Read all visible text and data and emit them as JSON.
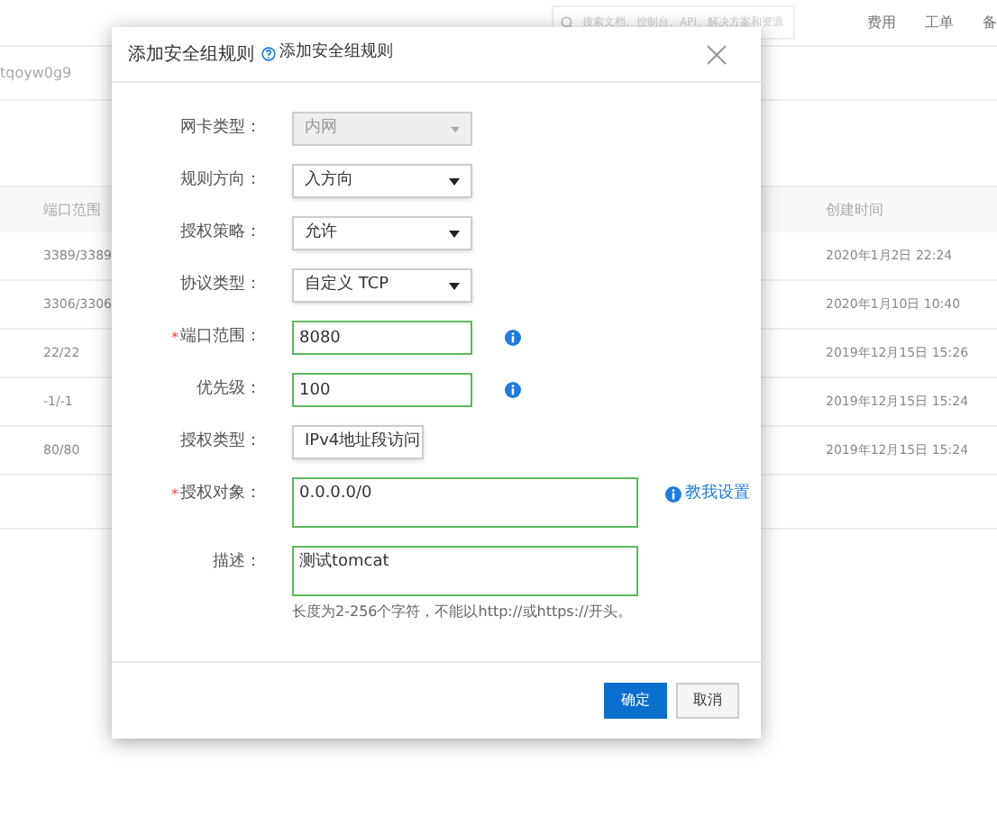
{
  "header": {
    "search": {
      "placeholder": "搜索文档、控制台、API、解决方案和资源"
    },
    "links": [
      "费用",
      "工单",
      "备"
    ]
  },
  "page": {
    "id_text": "tqoyw0g9",
    "table": {
      "columns": [
        "端口范围",
        "创建时间"
      ],
      "rows": [
        [
          "3389/3389",
          "2020年1月2日 22:24"
        ],
        [
          "3306/3306",
          "2020年1月10日 10:40"
        ],
        [
          "22/22",
          "2019年12月15日 15:26"
        ],
        [
          "-1/-1",
          "2019年12月15日 15:24"
        ],
        [
          "80/80",
          "2019年12月15日 15:24"
        ]
      ]
    }
  },
  "dialog": {
    "title": "添加安全组规则",
    "help_link": "添加安全组规则",
    "fields": [
      {
        "kind": "select",
        "label": "网卡类型：",
        "value": "内网",
        "disabled": true
      },
      {
        "kind": "select",
        "label": "规则方向：",
        "value": "入方向",
        "disabled": false
      },
      {
        "kind": "select",
        "label": "授权策略：",
        "value": "允许",
        "disabled": false
      },
      {
        "kind": "select",
        "label": "协议类型：",
        "value": "自定义 TCP",
        "disabled": false
      },
      {
        "kind": "input",
        "label": "端口范围：",
        "value": "8080",
        "required_mark": "*",
        "info": true
      },
      {
        "kind": "input",
        "label": "优先级：",
        "value": "100",
        "info": true
      },
      {
        "kind": "small_select",
        "label": "授权类型：",
        "value": "IPv4地址段访问",
        "disabled": false
      },
      {
        "kind": "textarea",
        "label": "授权对象：",
        "value": "0.0.0.0/0",
        "required_mark": "*",
        "link": "教我设置"
      },
      {
        "kind": "textarea",
        "label": "描述：",
        "value": "测试tomcat",
        "hint": "长度为2-256个字符，不能以http://或https://开头。"
      }
    ],
    "buttons": [
      {
        "label": "确定",
        "primary": true
      },
      {
        "label": "取消",
        "primary": false
      }
    ]
  }
}
